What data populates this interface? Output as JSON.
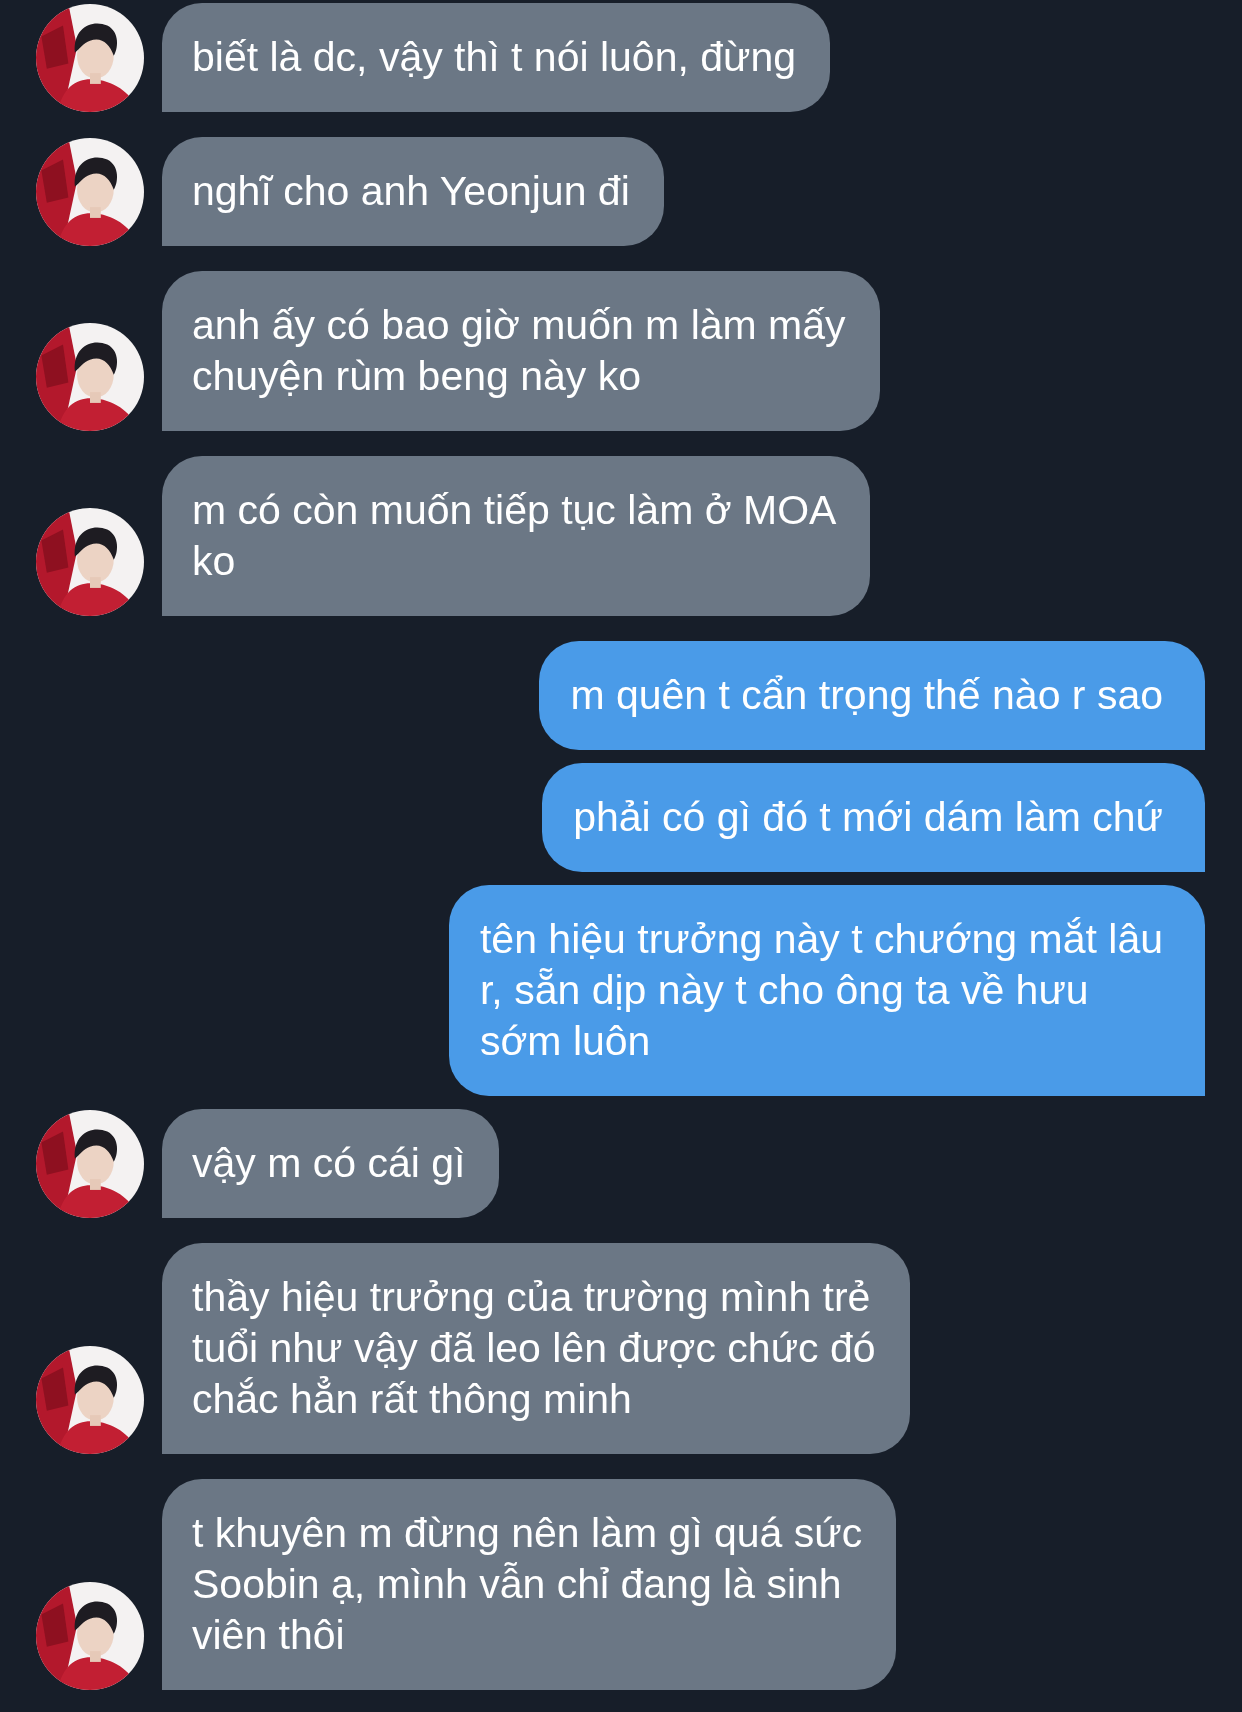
{
  "messages": [
    {
      "outgoing": false,
      "lines": [
        "biết là dc, vậy thì t nói luôn, đừng"
      ]
    },
    {
      "outgoing": false,
      "lines": [
        "nghĩ cho anh Yeonjun đi"
      ]
    },
    {
      "outgoing": false,
      "lines": [
        "anh ấy có bao giờ muốn m làm mấy",
        "chuyện rùm beng này ko"
      ]
    },
    {
      "outgoing": false,
      "lines": [
        "m có còn muốn tiếp tục làm ở MOA",
        "ko"
      ]
    },
    {
      "outgoing": true,
      "lines": [
        "m quên t cẩn trọng thế nào r sao"
      ]
    },
    {
      "outgoing": true,
      "lines": [
        "phải có gì đó t mới dám làm chứ"
      ]
    },
    {
      "outgoing": true,
      "lines": [
        "tên hiệu trưởng này t chướng mắt lâu",
        "r, sẵn dịp này t cho ông ta về hưu",
        "sớm luôn"
      ]
    },
    {
      "outgoing": false,
      "lines": [
        "vậy m có cái gì"
      ]
    },
    {
      "outgoing": false,
      "lines": [
        "thầy hiệu trưởng của trường mình trẻ",
        "tuổi như vậy đã leo lên được chức đó",
        "chắc hẳn rất thông minh"
      ]
    },
    {
      "outgoing": false,
      "lines": [
        "t khuyên m đừng nên làm gì quá sức",
        "Soobin ạ, mình vẫn chỉ đang là sinh",
        "viên thôi"
      ]
    }
  ]
}
